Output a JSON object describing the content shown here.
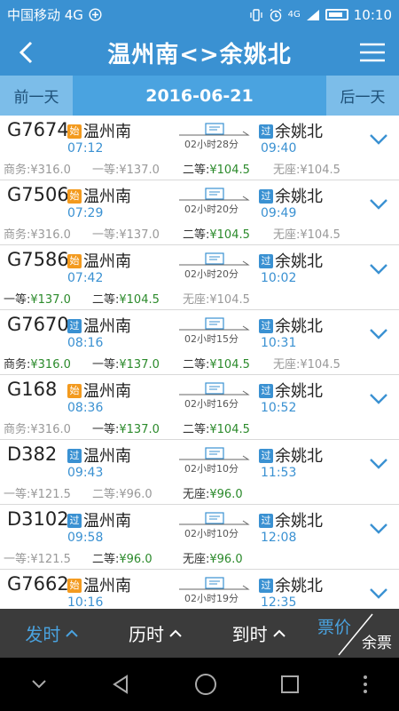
{
  "status": {
    "carrier": "中国移动 4G",
    "time": "10:10",
    "signal": "4G"
  },
  "header": {
    "title": "温州南<>余姚北"
  },
  "datebar": {
    "prev": "前一天",
    "date": "2016-06-21",
    "next": "后一天"
  },
  "trains": [
    {
      "id": "G7674",
      "dep_tag": "始",
      "dep_station": "温州南",
      "dep_time": "07:12",
      "duration": "02小时28分",
      "arr_tag": "过",
      "arr_station": "余姚北",
      "arr_time": "09:40",
      "seats": [
        {
          "label": "商务:",
          "price": "¥316.0",
          "avail": false
        },
        {
          "label": "一等:",
          "price": "¥137.0",
          "avail": false
        },
        {
          "label": "二等:",
          "price": "¥104.5",
          "avail": true
        },
        {
          "label": "无座:",
          "price": "¥104.5",
          "avail": false
        }
      ]
    },
    {
      "id": "G7506",
      "dep_tag": "始",
      "dep_station": "温州南",
      "dep_time": "07:29",
      "duration": "02小时20分",
      "arr_tag": "过",
      "arr_station": "余姚北",
      "arr_time": "09:49",
      "seats": [
        {
          "label": "商务:",
          "price": "¥316.0",
          "avail": false
        },
        {
          "label": "一等:",
          "price": "¥137.0",
          "avail": false
        },
        {
          "label": "二等:",
          "price": "¥104.5",
          "avail": true
        },
        {
          "label": "无座:",
          "price": "¥104.5",
          "avail": false
        }
      ]
    },
    {
      "id": "G7586",
      "dep_tag": "始",
      "dep_station": "温州南",
      "dep_time": "07:42",
      "duration": "02小时20分",
      "arr_tag": "过",
      "arr_station": "余姚北",
      "arr_time": "10:02",
      "seats": [
        {
          "label": "一等:",
          "price": "¥137.0",
          "avail": true
        },
        {
          "label": "二等:",
          "price": "¥104.5",
          "avail": true
        },
        {
          "label": "无座:",
          "price": "¥104.5",
          "avail": false
        },
        {
          "label": "",
          "price": "",
          "avail": false
        }
      ]
    },
    {
      "id": "G7670",
      "dep_tag": "过",
      "dep_station": "温州南",
      "dep_time": "08:16",
      "duration": "02小时15分",
      "arr_tag": "过",
      "arr_station": "余姚北",
      "arr_time": "10:31",
      "seats": [
        {
          "label": "商务:",
          "price": "¥316.0",
          "avail": true
        },
        {
          "label": "一等:",
          "price": "¥137.0",
          "avail": true
        },
        {
          "label": "二等:",
          "price": "¥104.5",
          "avail": true
        },
        {
          "label": "无座:",
          "price": "¥104.5",
          "avail": false
        }
      ]
    },
    {
      "id": "G168",
      "dep_tag": "始",
      "dep_station": "温州南",
      "dep_time": "08:36",
      "duration": "02小时16分",
      "arr_tag": "过",
      "arr_station": "余姚北",
      "arr_time": "10:52",
      "seats": [
        {
          "label": "商务:",
          "price": "¥316.0",
          "avail": false
        },
        {
          "label": "一等:",
          "price": "¥137.0",
          "avail": true
        },
        {
          "label": "二等:",
          "price": "¥104.5",
          "avail": true
        },
        {
          "label": "",
          "price": "",
          "avail": false
        }
      ]
    },
    {
      "id": "D382",
      "dep_tag": "过",
      "dep_station": "温州南",
      "dep_time": "09:43",
      "duration": "02小时10分",
      "arr_tag": "过",
      "arr_station": "余姚北",
      "arr_time": "11:53",
      "seats": [
        {
          "label": "一等:",
          "price": "¥121.5",
          "avail": false
        },
        {
          "label": "二等:",
          "price": "¥96.0",
          "avail": false
        },
        {
          "label": "无座:",
          "price": "¥96.0",
          "avail": true
        },
        {
          "label": "",
          "price": "",
          "avail": false
        }
      ]
    },
    {
      "id": "D3102",
      "dep_tag": "过",
      "dep_station": "温州南",
      "dep_time": "09:58",
      "duration": "02小时10分",
      "arr_tag": "过",
      "arr_station": "余姚北",
      "arr_time": "12:08",
      "seats": [
        {
          "label": "一等:",
          "price": "¥121.5",
          "avail": false
        },
        {
          "label": "二等:",
          "price": "¥96.0",
          "avail": true
        },
        {
          "label": "无座:",
          "price": "¥96.0",
          "avail": true
        },
        {
          "label": "",
          "price": "",
          "avail": false
        }
      ]
    },
    {
      "id": "G7662",
      "dep_tag": "始",
      "dep_station": "温州南",
      "dep_time": "10:16",
      "duration": "02小时19分",
      "arr_tag": "过",
      "arr_station": "余姚北",
      "arr_time": "12:35",
      "seats": []
    }
  ],
  "tabs": {
    "depart": "发时",
    "duration": "历时",
    "arrive": "到时",
    "price": "票价",
    "remaining": "余票"
  },
  "colors": {
    "primary": "#3a91d2",
    "available": "#2b8a2b",
    "unavailable": "#999999",
    "start_tag": "#f39a1e"
  }
}
